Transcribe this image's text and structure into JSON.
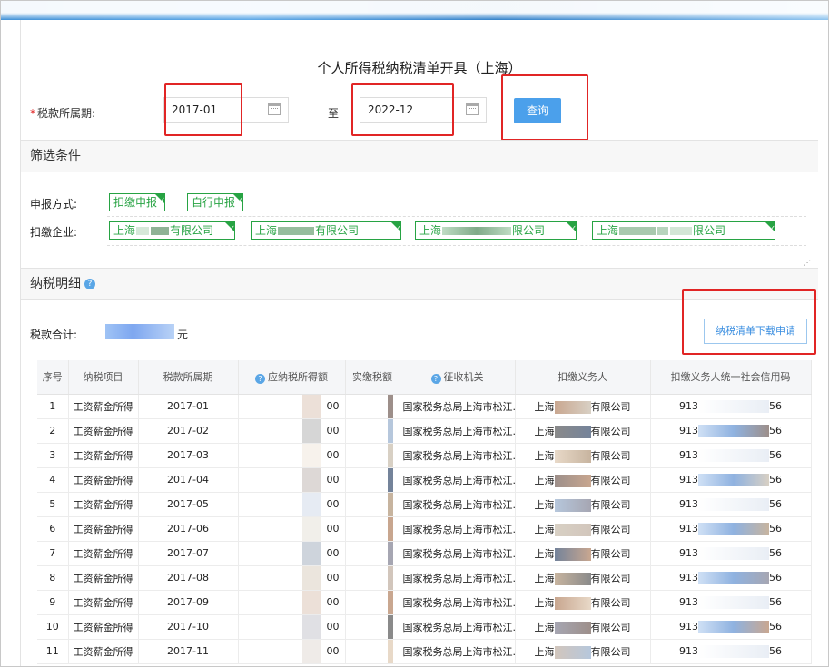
{
  "page_title": "个人所得税纳税清单开具（上海）",
  "period": {
    "label": "税款所属期:",
    "required_mark": "*",
    "start": "2017-01",
    "to_label": "至",
    "end": "2022-12",
    "query_button": "查询"
  },
  "filter": {
    "heading": "筛选条件",
    "declare_label": "申报方式:",
    "declare_options": [
      "扣缴申报",
      "自行申报"
    ],
    "company_label": "扣缴企业:",
    "companies": [
      {
        "prefix": "上海",
        "suffix": "有限公司"
      },
      {
        "prefix": "上海",
        "suffix": "有限公司"
      },
      {
        "prefix": "上海",
        "suffix": "限公司"
      },
      {
        "prefix": "上海",
        "suffix": "限公司"
      }
    ]
  },
  "detail": {
    "heading": "纳税明细",
    "total_label": "税款合计:",
    "total_unit": "元",
    "download_button": "纳税清单下载申请"
  },
  "table": {
    "headers": [
      "序号",
      "纳税项目",
      "税款所属期",
      "应纳税所得额",
      "实缴税额",
      "征收机关",
      "扣缴义务人",
      "扣缴义务人统一社会信用码"
    ],
    "rows": [
      {
        "no": "1",
        "item": "工资薪金所得",
        "period": "2017-01",
        "taxable": "00",
        "paid": "0",
        "authority": "国家税务总局上海市松江...",
        "agent_a": "上海",
        "agent_b": "有限公司",
        "credit_a": "913",
        "credit_b": "56"
      },
      {
        "no": "2",
        "item": "工资薪金所得",
        "period": "2017-02",
        "taxable": "00",
        "paid": "0",
        "authority": "国家税务总局上海市松江...",
        "agent_a": "上海",
        "agent_b": "有限公司",
        "credit_a": "913",
        "credit_b": "56"
      },
      {
        "no": "3",
        "item": "工资薪金所得",
        "period": "2017-03",
        "taxable": "00",
        "paid": "0",
        "authority": "国家税务总局上海市松江...",
        "agent_a": "上海",
        "agent_b": "有限公司",
        "credit_a": "913",
        "credit_b": "56"
      },
      {
        "no": "4",
        "item": "工资薪金所得",
        "period": "2017-04",
        "taxable": "00",
        "paid": "5",
        "authority": "国家税务总局上海市松江...",
        "agent_a": "上海",
        "agent_b": "有限公司",
        "credit_a": "913",
        "credit_b": "56"
      },
      {
        "no": "5",
        "item": "工资薪金所得",
        "period": "2017-05",
        "taxable": "00",
        "paid": "5",
        "authority": "国家税务总局上海市松江...",
        "agent_a": "上海",
        "agent_b": "有限公司",
        "credit_a": "913",
        "credit_b": "56"
      },
      {
        "no": "6",
        "item": "工资薪金所得",
        "period": "2017-06",
        "taxable": "00",
        "paid": "5",
        "authority": "国家税务总局上海市松江...",
        "agent_a": "上海",
        "agent_b": "有限公司",
        "credit_a": "913",
        "credit_b": "56"
      },
      {
        "no": "7",
        "item": "工资薪金所得",
        "period": "2017-07",
        "taxable": "00",
        "paid": "5",
        "authority": "国家税务总局上海市松江...",
        "agent_a": "上海",
        "agent_b": "有限公司",
        "credit_a": "913",
        "credit_b": "56"
      },
      {
        "no": "8",
        "item": "工资薪金所得",
        "period": "2017-08",
        "taxable": "00",
        "paid": "5",
        "authority": "国家税务总局上海市松江...",
        "agent_a": "上海",
        "agent_b": "有限公司",
        "credit_a": "913",
        "credit_b": "56"
      },
      {
        "no": "9",
        "item": "工资薪金所得",
        "period": "2017-09",
        "taxable": "00",
        "paid": "5",
        "authority": "国家税务总局上海市松江...",
        "agent_a": "上海",
        "agent_b": "有限公司",
        "credit_a": "913",
        "credit_b": "56"
      },
      {
        "no": "10",
        "item": "工资薪金所得",
        "period": "2017-10",
        "taxable": "00",
        "paid": "5",
        "authority": "国家税务总局上海市松江...",
        "agent_a": "上海",
        "agent_b": "有限公司",
        "credit_a": "913",
        "credit_b": "56"
      },
      {
        "no": "11",
        "item": "工资薪金所得",
        "period": "2017-11",
        "taxable": "00",
        "paid": "5",
        "authority": "国家税务总局上海市松江...",
        "agent_a": "上海",
        "agent_b": "有限公司",
        "credit_a": "913",
        "credit_b": "56"
      }
    ]
  },
  "colors": {
    "accent": "#4ba0eb",
    "tag_green": "#27a343",
    "highlight_red": "#e12525"
  },
  "icons": [
    "calendar-icon",
    "help-icon",
    "check-icon",
    "resize-icon"
  ]
}
